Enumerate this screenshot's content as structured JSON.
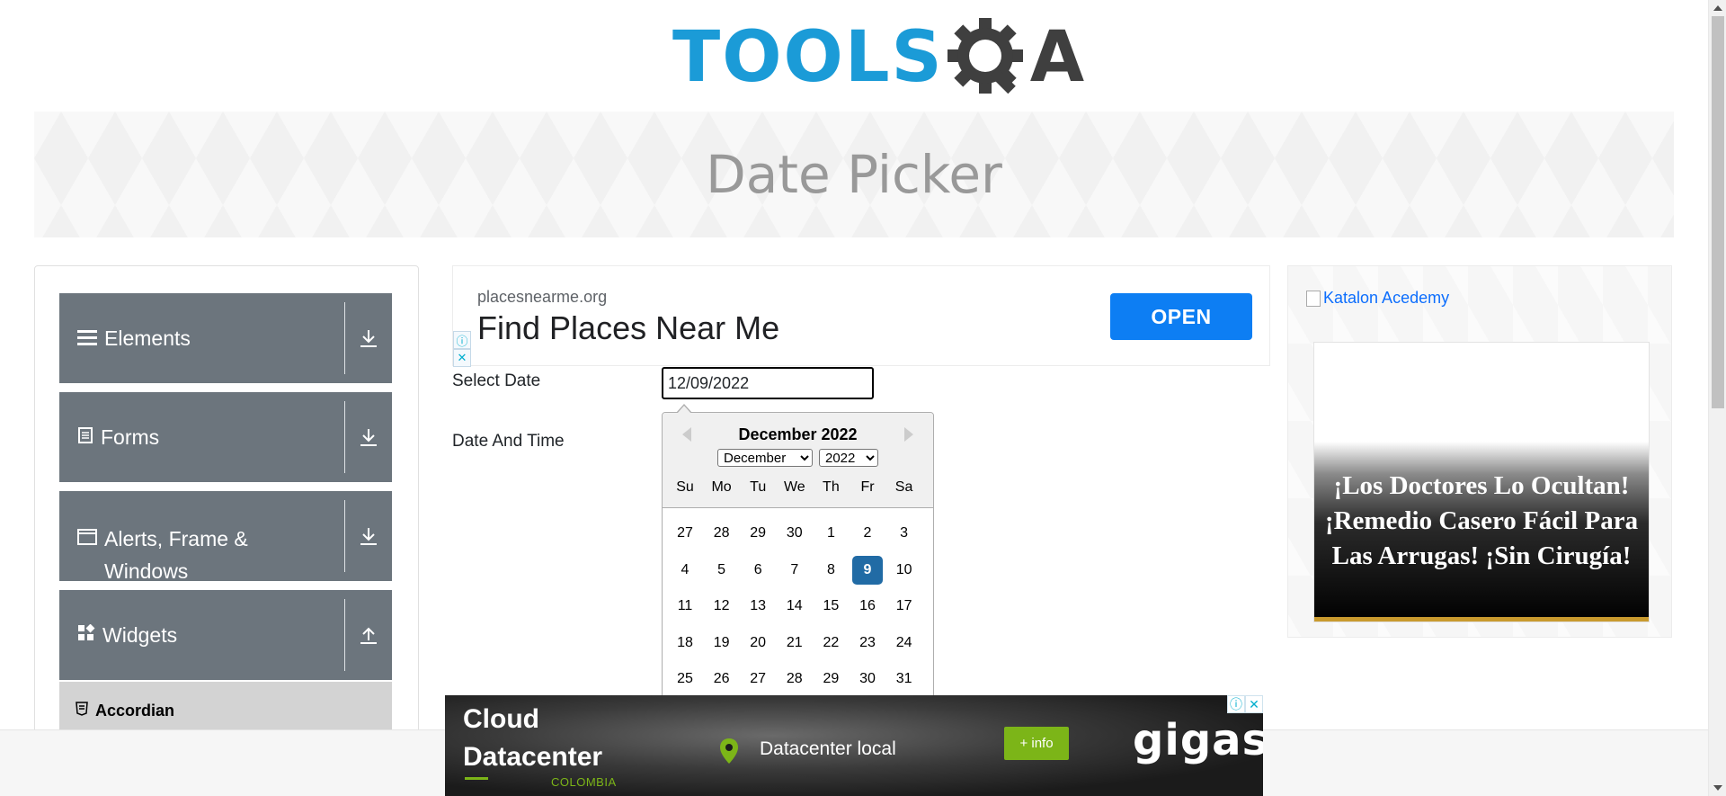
{
  "brand": {
    "logo_text": "TOOLS",
    "logo_suffix": "A",
    "logo_primary_color": "#1b9bd7",
    "logo_secondary_color": "#3f3f3f"
  },
  "page": {
    "title": "Date Picker"
  },
  "sidebar": {
    "groups": [
      {
        "label": "Elements",
        "icon": "menu-icon",
        "toggle_icon": "download-arrow-icon"
      },
      {
        "label": "Forms",
        "icon": "document-icon",
        "toggle_icon": "download-arrow-icon"
      },
      {
        "label": "Alerts, Frame &",
        "label_line2": "Windows",
        "icon": "window-icon",
        "toggle_icon": "download-arrow-icon"
      },
      {
        "label": "Widgets",
        "icon": "widgets-icon",
        "toggle_icon": "upload-arrow-icon"
      }
    ],
    "sub_items": [
      {
        "label": "Accordian",
        "icon": "html5-icon"
      }
    ]
  },
  "ad_top": {
    "domain": "placesnearme.org",
    "headline": "Find Places Near Me",
    "button": "OPEN",
    "choices": [
      "ⓘ",
      "✕"
    ]
  },
  "form": {
    "select_date_label": "Select Date",
    "select_date_value": "12/09/2022",
    "date_time_label": "Date And Time"
  },
  "datepicker": {
    "header": "December 2022",
    "month_select": "December",
    "year_select": "2022",
    "weekdays": [
      "Su",
      "Mo",
      "Tu",
      "We",
      "Th",
      "Fr",
      "Sa"
    ],
    "weeks": [
      [
        "27",
        "28",
        "29",
        "30",
        "1",
        "2",
        "3"
      ],
      [
        "4",
        "5",
        "6",
        "7",
        "8",
        "9",
        "10"
      ],
      [
        "11",
        "12",
        "13",
        "14",
        "15",
        "16",
        "17"
      ],
      [
        "18",
        "19",
        "20",
        "21",
        "22",
        "23",
        "24"
      ],
      [
        "25",
        "26",
        "27",
        "28",
        "29",
        "30",
        "31"
      ]
    ],
    "selected_day": "9",
    "selected_color": "#216ba5"
  },
  "right_ad": {
    "image_alt": "Katalon Acedemy",
    "headline": "¡Los Doctores Lo Ocultan! ¡Remedio Casero Fácil Para Las Arrugas! ¡Sin Cirugía!"
  },
  "ad_bottom": {
    "line1": "Cloud",
    "line2": "Datacenter",
    "country": "COLOMBIA",
    "location": "Datacenter local",
    "button": "+ info",
    "brand": "gigas",
    "accent_color": "#7cb518"
  }
}
